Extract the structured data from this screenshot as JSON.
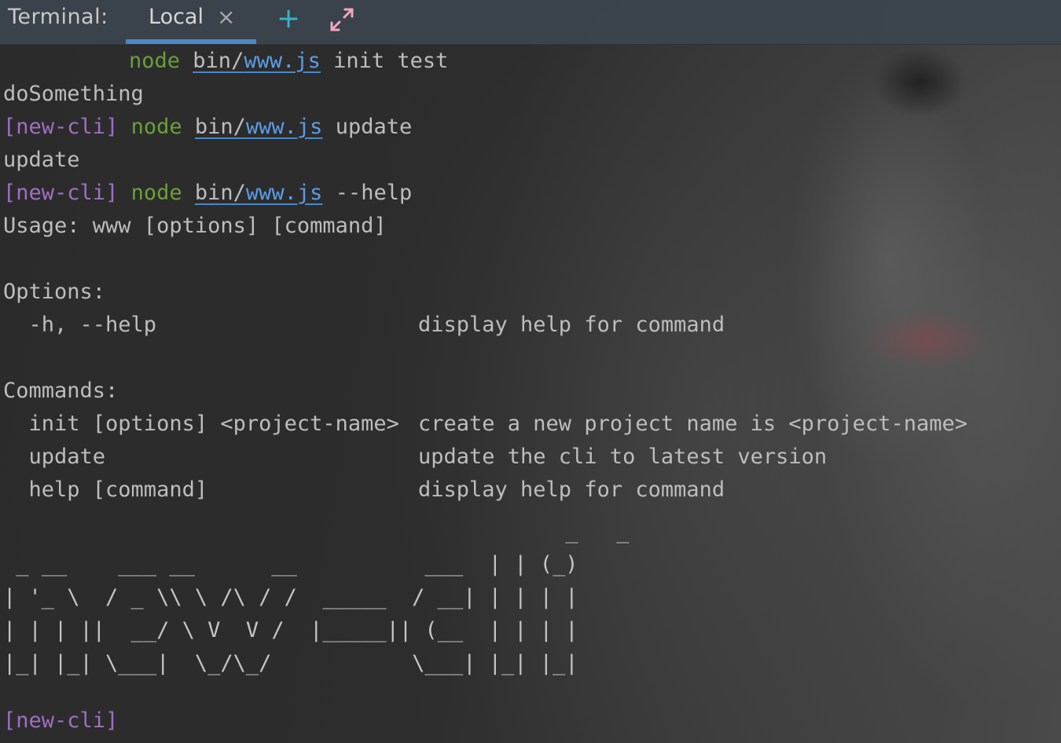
{
  "tabbar": {
    "title": "Terminal:",
    "tabs": [
      {
        "label": "Local",
        "active": true
      }
    ],
    "close_glyph": "×",
    "add_glyph": "+",
    "icons": {
      "add": "plus-icon",
      "close": "close-icon",
      "expand": "expand-arrows-icon"
    },
    "accent_color": "#4a88c7"
  },
  "terminal": {
    "colors": {
      "prompt": "#9f6fc3",
      "command": "#6a9f3a",
      "link": "#5c9ce6",
      "text": "#bdbdbd"
    },
    "lines": [
      {
        "prompt": "",
        "cmd": "node",
        "path_dir": "bin/",
        "path_file": "www.js",
        "args": "init test"
      },
      {
        "text": "doSomething"
      },
      {
        "prompt": "[new-cli]",
        "cmd": "node",
        "path_dir": "bin/",
        "path_file": "www.js",
        "args": "update"
      },
      {
        "text": "update"
      },
      {
        "prompt": "[new-cli]",
        "cmd": "node",
        "path_dir": "bin/",
        "path_file": "www.js",
        "args": "--help"
      },
      {
        "text": "Usage: www [options] [command]"
      },
      {
        "text": ""
      },
      {
        "text": "Options:"
      },
      {
        "left": "  -h, --help",
        "right": "display help for command"
      },
      {
        "text": ""
      },
      {
        "text": "Commands:"
      },
      {
        "left": "  init [options] <project-name>",
        "right": "create a new project name is <project-name>"
      },
      {
        "left": "  update",
        "right": "update the cli to latest version"
      },
      {
        "left": "  help [command]",
        "right": "display help for command"
      }
    ],
    "banner": "                                            _   _ \n _ __    ___ __      __          ___  | | (_)\n| '_ \\  / _ \\\\ \\ /\\ / /  _____  / __| | | | |\n| | | ||  __/ \\ V  V /  |_____|| (__  | | | |\n|_| |_| \\___|  \\_/\\_/           \\___| |_| |_|",
    "final_prompt": "[new-cli]"
  }
}
